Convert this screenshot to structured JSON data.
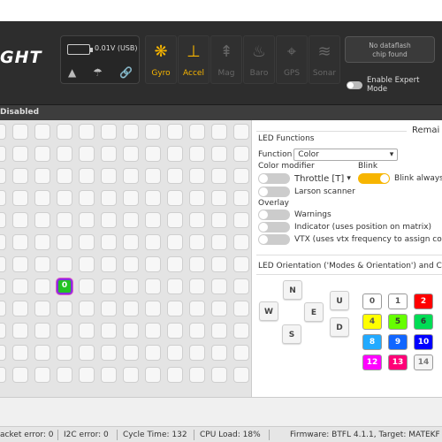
{
  "header": {
    "logo_text": "GHT",
    "battery": {
      "text": "0.01V (USB)"
    },
    "status_icons": [
      "warning-icon",
      "parachute-icon",
      "link-icon"
    ],
    "sensors": [
      {
        "label": "Gyro",
        "icon": "gyro-icon",
        "active": true
      },
      {
        "label": "Accel",
        "icon": "accel-icon",
        "active": true
      },
      {
        "label": "Mag",
        "icon": "mag-icon",
        "active": false
      },
      {
        "label": "Baro",
        "icon": "baro-icon",
        "active": false
      },
      {
        "label": "GPS",
        "icon": "gps-icon",
        "active": false
      },
      {
        "label": "Sonar",
        "icon": "sonar-icon",
        "active": false
      }
    ],
    "dataflash": {
      "line1": "No dataflash",
      "line2": "chip found"
    },
    "expert_mode_label": "Enable Expert Mode"
  },
  "subbar": {
    "text": "Disabled"
  },
  "grid": {
    "active_index": "0"
  },
  "panel": {
    "remaining": "Remai",
    "led_functions_title": "LED Functions",
    "function_label": "Function",
    "function_value": "Color",
    "color_modifier_label": "Color modifier",
    "throttle_value": "Throttle [T]",
    "blink_label": "Blink",
    "blink_always_label": "Blink always",
    "larson_scanner_label": "Larson scanner",
    "overlay_label": "Overlay",
    "warnings_label": "Warnings",
    "indicator_label": "Indicator (uses position on matrix)",
    "vtx_label": "VTX (uses vtx frequency to assign colo",
    "orientation_title": "LED Orientation ('Modes & Orientation') and C",
    "directions": {
      "n": "N",
      "w": "W",
      "e": "E",
      "s": "S",
      "u": "U",
      "d": "D"
    },
    "colors": [
      {
        "num": "0",
        "bg": "#ffffff",
        "fg": "#555555"
      },
      {
        "num": "1",
        "bg": "#ffffff",
        "fg": "#555555"
      },
      {
        "num": "2",
        "bg": "#ff0000",
        "fg": "#ffffff"
      },
      {
        "num": "4",
        "bg": "#ffff00",
        "fg": "#555555"
      },
      {
        "num": "5",
        "bg": "#66ff00",
        "fg": "#333333"
      },
      {
        "num": "6",
        "bg": "#00dd55",
        "fg": "#333333"
      },
      {
        "num": "8",
        "bg": "#22aaff",
        "fg": "#ffffff"
      },
      {
        "num": "9",
        "bg": "#1166ff",
        "fg": "#ffffff"
      },
      {
        "num": "10",
        "bg": "#0000ff",
        "fg": "#ffffff"
      },
      {
        "num": "12",
        "bg": "#ff00ff",
        "fg": "#ffffff"
      },
      {
        "num": "13",
        "bg": "#ff0077",
        "fg": "#ffffff"
      },
      {
        "num": "14",
        "bg": "#f4f4f4",
        "fg": "#777777"
      }
    ]
  },
  "statusbar": {
    "packet_error": "acket error: 0",
    "i2c_error": "I2C error: 0",
    "cycle_time": "Cycle Time: 132",
    "cpu_load": "CPU Load: 18%",
    "firmware": "Firmware: BTFL 4.1.1, Target: MATEKF"
  }
}
